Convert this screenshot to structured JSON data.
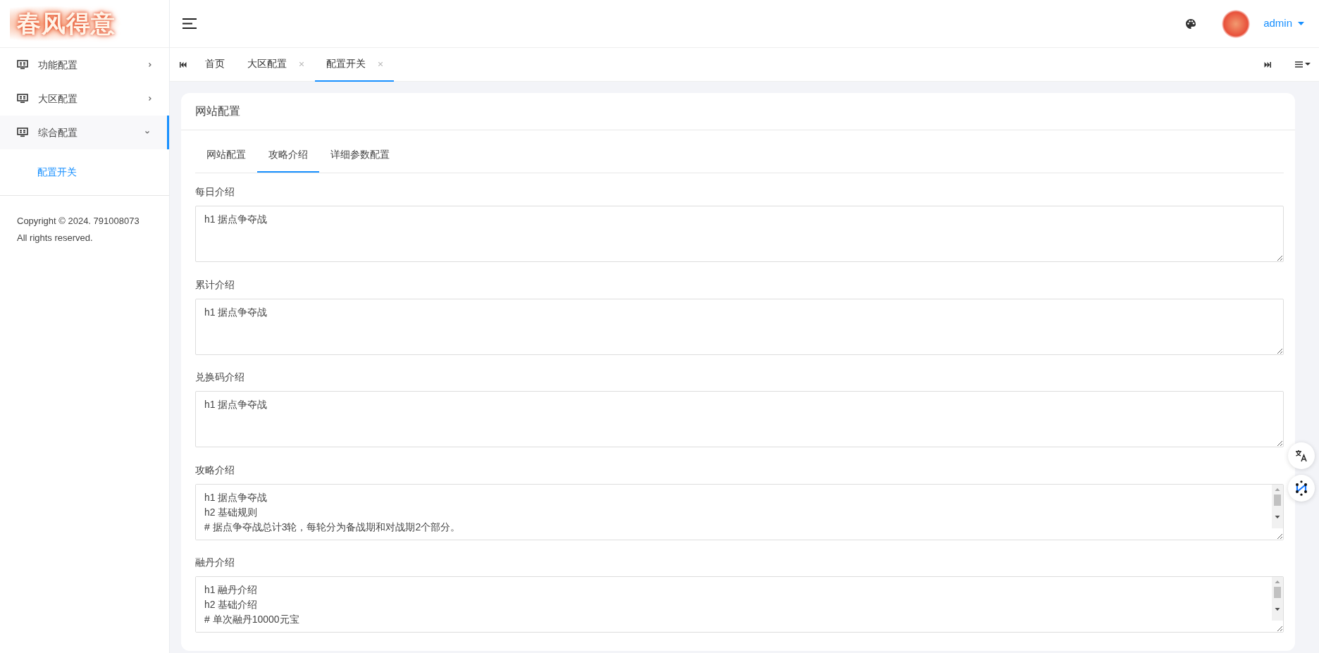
{
  "logo": {
    "text": "春风得意"
  },
  "sidebar": {
    "items": [
      {
        "label": "功能配置",
        "expanded": false,
        "selected": false
      },
      {
        "label": "大区配置",
        "expanded": false,
        "selected": false
      },
      {
        "label": "综合配置",
        "expanded": true,
        "selected": true,
        "children": [
          {
            "label": "配置开关",
            "selected": true
          }
        ]
      }
    ],
    "footer": [
      "Copyright © 2024. 791008073",
      "All rights reserved."
    ]
  },
  "topbar": {
    "user": "admin"
  },
  "tabs": [
    {
      "label": "首页",
      "closable": false,
      "selected": false
    },
    {
      "label": "大区配置",
      "closable": true,
      "selected": false
    },
    {
      "label": "配置开关",
      "closable": true,
      "selected": true
    }
  ],
  "card": {
    "title": "网站配置",
    "tabs": [
      {
        "label": "网站配置",
        "selected": false
      },
      {
        "label": "攻略介绍",
        "selected": true
      },
      {
        "label": "详细参数配置",
        "selected": false
      }
    ],
    "fields": [
      {
        "label": "每日介绍",
        "value": "h1 据点争夺战",
        "scrollable": false
      },
      {
        "label": "累计介绍",
        "value": "h1 据点争夺战",
        "scrollable": false
      },
      {
        "label": "兑换码介绍",
        "value": "h1 据点争夺战",
        "scrollable": false
      },
      {
        "label": "攻略介绍",
        "value": "h1 据点争夺战\nh2 基础规则\n# 据点争夺战总计3轮，每轮分为备战期和对战期2个部分。",
        "scrollable": true
      },
      {
        "label": "融丹介绍",
        "value": "h1 融丹介绍\nh2 基础介绍\n# 单次融丹10000元宝",
        "scrollable": true
      }
    ]
  }
}
